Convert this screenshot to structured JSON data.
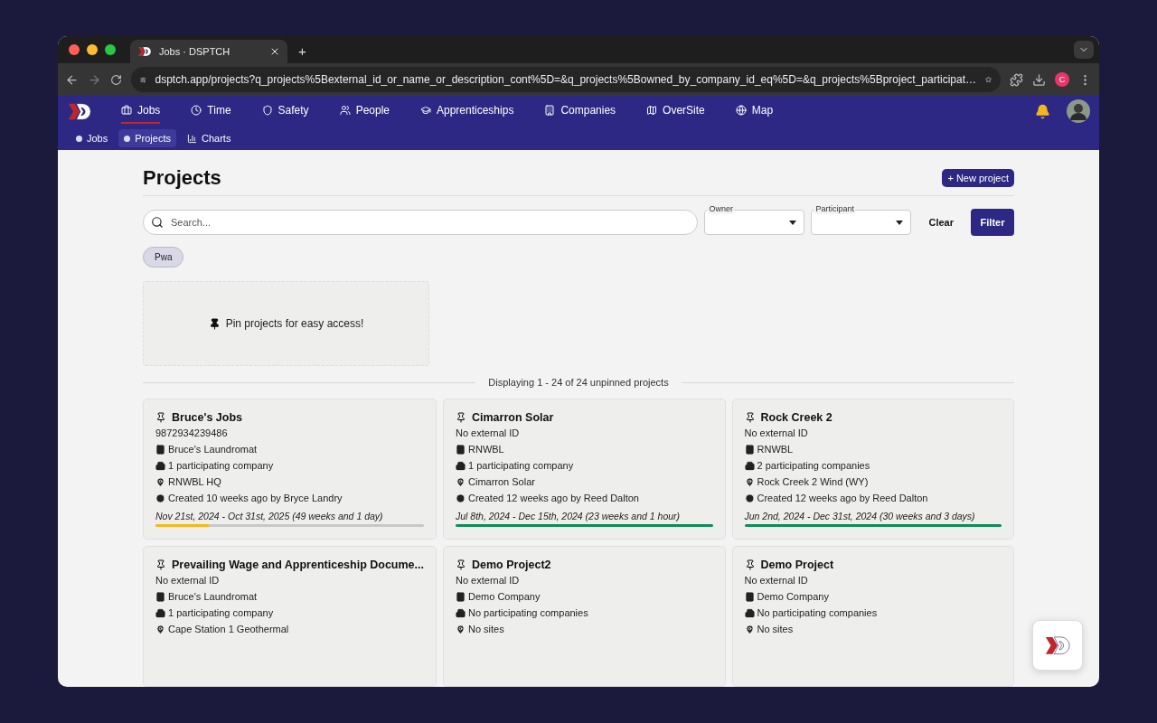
{
  "browser": {
    "tab_title": "Jobs · DSPTCH",
    "new_tab": "+",
    "url": "dsptch.app/projects?q_projects%5Bexternal_id_or_name_or_description_cont%5D=&q_projects%5Bowned_by_company_id_eq%5D=&q_projects%5Bproject_participat…",
    "profile": "C"
  },
  "nav": [
    {
      "label": "Jobs",
      "selected": true
    },
    {
      "label": "Time",
      "selected": false
    },
    {
      "label": "Safety",
      "selected": false
    },
    {
      "label": "People",
      "selected": false
    },
    {
      "label": "Apprenticeships",
      "selected": false
    },
    {
      "label": "Companies",
      "selected": false
    },
    {
      "label": "OverSite",
      "selected": false
    },
    {
      "label": "Map",
      "selected": false
    }
  ],
  "subnav": [
    {
      "label": "Jobs",
      "selected": false
    },
    {
      "label": "Projects",
      "selected": true
    },
    {
      "label": "Charts",
      "selected": false
    }
  ],
  "page": {
    "title": "Projects",
    "new_button": "+ New project"
  },
  "filters": {
    "search_placeholder": "Search...",
    "owner_label": "Owner",
    "participant_label": "Participant",
    "clear": "Clear",
    "filter": "Filter"
  },
  "tags": [
    "Pwa"
  ],
  "pinned_empty": "Pin projects for easy access!",
  "divider_text": "Displaying 1 - 24 of 24 unpinned projects",
  "projects": [
    {
      "name": "Bruce's Jobs",
      "external_id": "9872934239486",
      "company": "Bruce's Laundromat",
      "participants": "1 participating company",
      "site": "RNWBL HQ",
      "created": "Created 10 weeks ago by Bryce Landry",
      "timeline": {
        "text": "Nov 21st, 2024 - Oct 31st, 2025 (49 weeks and 1 day)",
        "level": 0.2,
        "color": "#f5b81c"
      }
    },
    {
      "name": "Cimarron Solar",
      "external_id": "No external ID",
      "company": "RNWBL",
      "participants": "1 participating company",
      "site": "Cimarron Solar",
      "created": "Created 12 weeks ago by Reed Dalton",
      "timeline": {
        "text": "Jul 8th, 2024 - Dec 15th, 2024 (23 weeks and 1 hour)",
        "level": 1,
        "color": "#0f8a5a"
      }
    },
    {
      "name": "Rock Creek 2",
      "external_id": "No external ID",
      "company": "RNWBL",
      "participants": "2 participating companies",
      "site": "Rock Creek 2 Wind (WY)",
      "created": "Created 12 weeks ago by Reed Dalton",
      "timeline": {
        "text": "Jun 2nd, 2024 - Dec 31st, 2024 (30 weeks and 3 days)",
        "level": 1,
        "color": "#0f8a5a"
      }
    },
    {
      "name": "Prevailing Wage and Apprenticeship Docume...",
      "external_id": "No external ID",
      "company": "Bruce's Laundromat",
      "participants": "1 participating company",
      "site": "Cape Station 1 Geothermal"
    },
    {
      "name": "Demo Project2",
      "external_id": "No external ID",
      "company": "Demo Company",
      "participants": "No participating companies",
      "site": "No sites"
    },
    {
      "name": "Demo Project",
      "external_id": "No external ID",
      "company": "Demo Company",
      "participants": "No participating companies",
      "site": "No sites"
    }
  ]
}
